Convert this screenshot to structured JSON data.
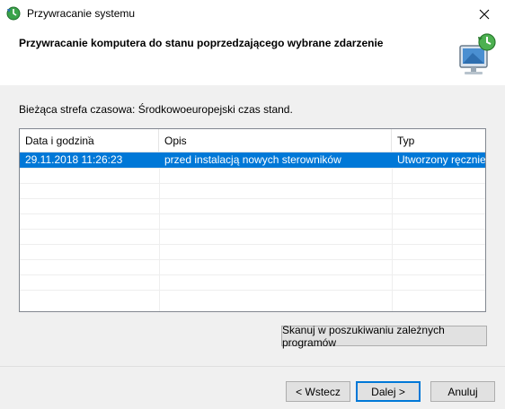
{
  "window": {
    "title": "Przywracanie systemu",
    "close_icon": "close-icon",
    "app_icon": "system-restore-icon"
  },
  "header": {
    "title": "Przywracanie komputera do stanu poprzedzającego wybrane zdarzenie",
    "icon": "restore-computer-icon"
  },
  "timezone_text": "Bieżąca strefa czasowa: Środkowoeuropejski czas stand.",
  "table": {
    "columns": [
      "Data i godzina",
      "Opis",
      "Typ"
    ],
    "sorted_column": "Data i godzina",
    "rows": [
      {
        "date": "29.11.2018 11:26:23",
        "description": "przed instalacją nowych sterowników",
        "type": "Utworzony ręcznie",
        "selected": true
      }
    ]
  },
  "buttons": {
    "scan": "Skanuj w poszukiwaniu zależnych programów",
    "back": "< Wstecz",
    "next": "Dalej >",
    "cancel": "Anuluj"
  },
  "colors": {
    "selection": "#0078d7",
    "background": "#f0f0f0"
  }
}
